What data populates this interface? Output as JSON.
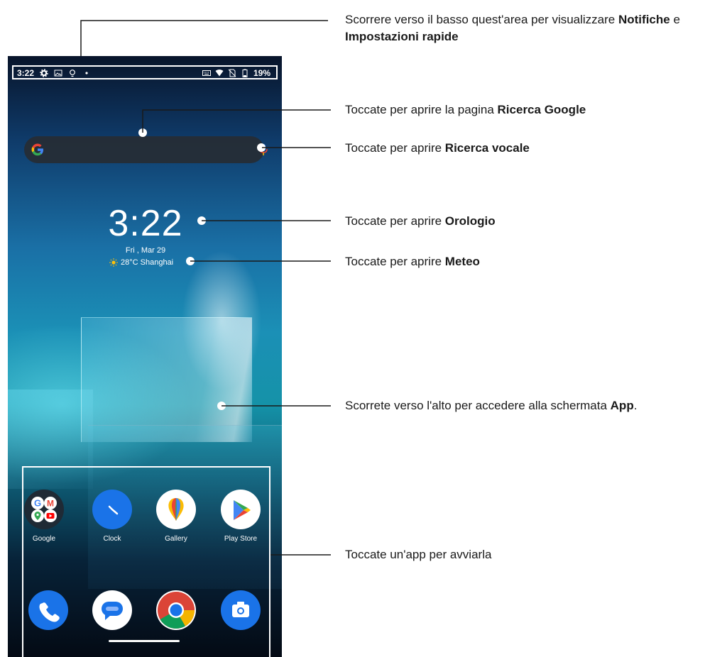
{
  "status_bar": {
    "time": "3:22",
    "icons": [
      "gear-icon",
      "image-icon",
      "bulb-icon",
      "dot-icon"
    ],
    "right_icons": [
      "keyboard-icon",
      "wifi-icon",
      "no-sim-icon",
      "battery-icon"
    ],
    "battery": "19%"
  },
  "search": {
    "icon": "google-g-icon",
    "mic": "mic-icon"
  },
  "clock": {
    "time": "3:22",
    "date": "Fri , Mar 29"
  },
  "weather": {
    "icon": "sun-icon",
    "text": "28°C Shanghai"
  },
  "apps_row1": [
    {
      "label": "Google",
      "icon": "google-folder-icon"
    },
    {
      "label": "Clock",
      "icon": "clock-icon"
    },
    {
      "label": "Gallery",
      "icon": "gallery-icon"
    },
    {
      "label": "Play Store",
      "icon": "play-store-icon"
    }
  ],
  "apps_row2": [
    {
      "icon": "phone-icon"
    },
    {
      "icon": "messages-icon"
    },
    {
      "icon": "chrome-icon"
    },
    {
      "icon": "camera-icon"
    }
  ],
  "callouts": {
    "status": {
      "pre": "Scorrere verso il basso quest'area per visualizzare ",
      "b1": "Notifiche",
      "mid": " e",
      "b2": "Impostazioni rapide"
    },
    "google": {
      "pre": "Toccate per aprire la pagina ",
      "b": "Ricerca Google"
    },
    "voice": {
      "pre": "Toccate per aprire ",
      "b": "Ricerca vocale"
    },
    "clock": {
      "pre": "Toccate per aprire ",
      "b": "Orologio"
    },
    "weather": {
      "pre": "Toccate per aprire ",
      "b": "Meteo"
    },
    "apps": {
      "pre": "Scorrete verso l'alto per accedere alla schermata ",
      "b": "App",
      "post": "."
    },
    "launch": {
      "text": "Toccate un'app per avviarla"
    }
  },
  "colors": {
    "blue": "#1a73e8",
    "callout_text": "#1a1a1a"
  }
}
